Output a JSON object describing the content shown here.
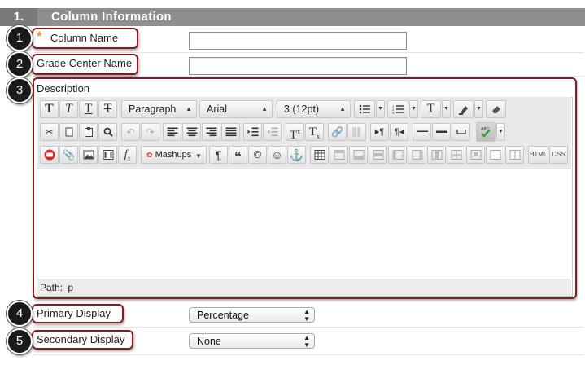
{
  "section": {
    "number": "1.",
    "title": "Column Information"
  },
  "fields": {
    "column_name": {
      "label": "Column Name",
      "required_mark": "*",
      "callout": "1",
      "value": ""
    },
    "grade_center_name": {
      "label": "Grade Center Name",
      "callout": "2",
      "value": ""
    },
    "description": {
      "label": "Description",
      "callout": "3"
    },
    "primary_display": {
      "label": "Primary Display",
      "callout": "4",
      "value": "Percentage"
    },
    "secondary_display": {
      "label": "Secondary Display",
      "callout": "5",
      "value": "None"
    }
  },
  "editor": {
    "format_select": "Paragraph",
    "font_select": "Arial",
    "size_select": "3 (12pt)",
    "mashups_label": "Mashups",
    "html_label": "HTML",
    "css_label": "CSS",
    "path_label": "Path:",
    "path_value": "p",
    "body_text": ""
  },
  "colors": {
    "header_bg": "#8f8f8f",
    "callout_ring": "#8b1a1f",
    "required_star": "#e8922a"
  }
}
